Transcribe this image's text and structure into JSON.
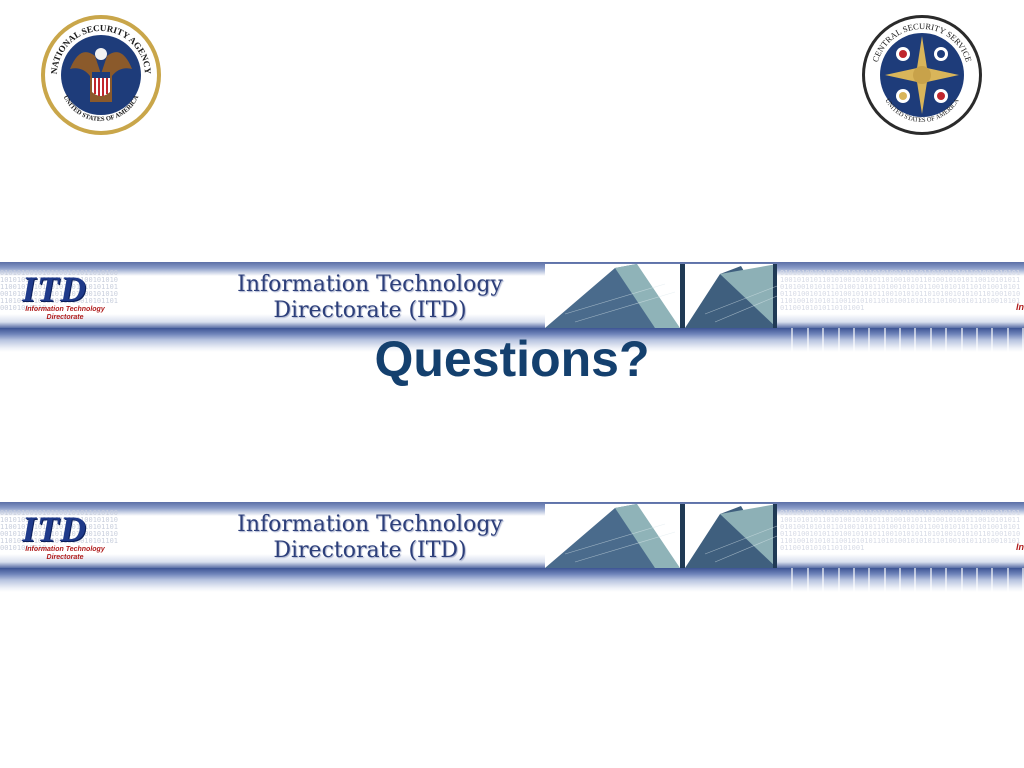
{
  "seals": {
    "left": {
      "icon": "nsa-seal-icon",
      "text_top": "NATIONAL SECURITY AGENCY",
      "text_bottom": "UNITED STATES OF AMERICA"
    },
    "right": {
      "icon": "css-seal-icon",
      "text_top": "CENTRAL SECURITY SERVICE",
      "text_bottom": "UNITED STATES OF AMERICA"
    }
  },
  "banner": {
    "logo_text": "ITD",
    "logo_subtext_line1": "Information Technology",
    "logo_subtext_line2": "Directorate",
    "title_line1": "Information Technology",
    "title_line2": "Directorate (ITD)",
    "edge_label": "In"
  },
  "slide": {
    "heading": "Questions?"
  },
  "colors": {
    "heading": "#14406e",
    "banner_blue": "#3d5494",
    "logo_blue": "#1f3a8a",
    "logo_red": "#b01c1c"
  }
}
